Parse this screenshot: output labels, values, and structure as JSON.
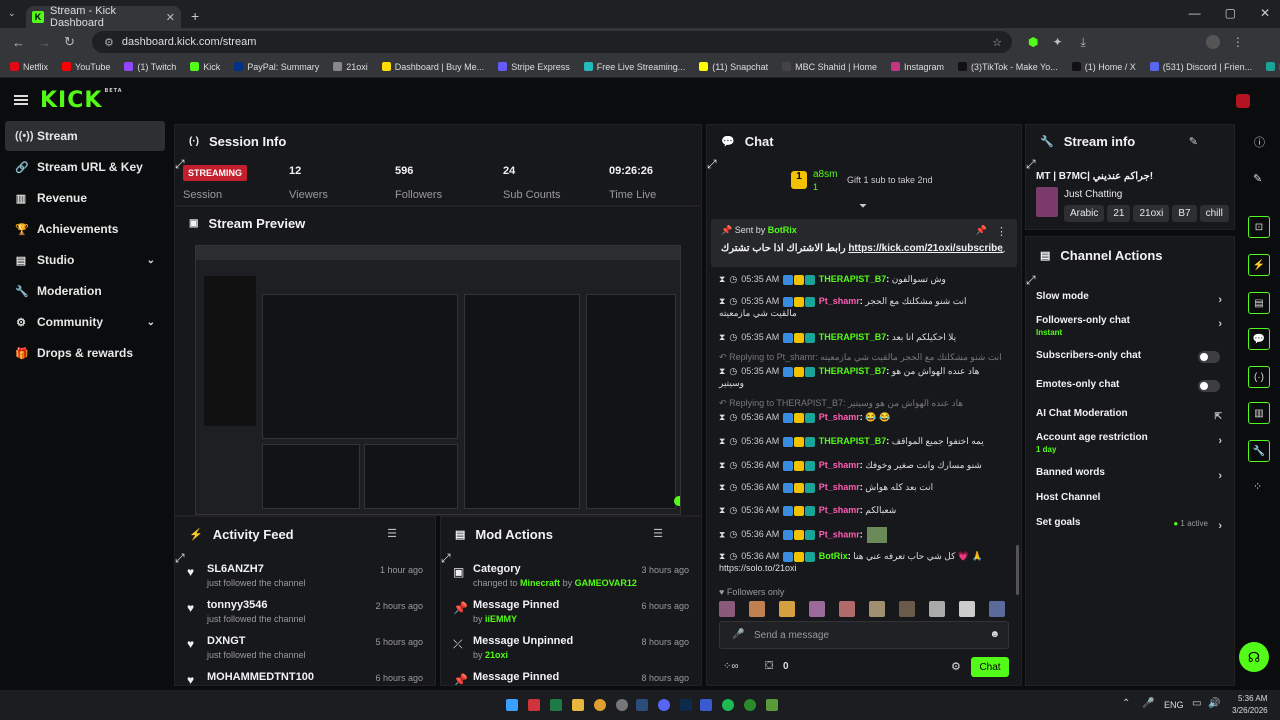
{
  "browser": {
    "tab_title": "Stream - Kick Dashboard",
    "url": "dashboard.kick.com/stream",
    "bookmarks": [
      "Netflix",
      "YouTube",
      "(1) Twitch",
      "Kick",
      "PayPal: Summary",
      "21oxi",
      "Dashboard | Buy Me...",
      "Stripe Express",
      "Free Live Streaming...",
      "(11) Snapchat",
      "MBC Shahid | Home",
      "Instagram",
      "(3)TikTok - Make Yo...",
      "(1) Home / X",
      "(531) Discord | Frien...",
      "Photopea | Online P..."
    ]
  },
  "app": {
    "logo": "KICK",
    "beta": "BETA"
  },
  "sidebar": {
    "items": [
      {
        "label": "Stream",
        "icon": "broadcast-icon"
      },
      {
        "label": "Stream URL & Key",
        "icon": "link-icon"
      },
      {
        "label": "Revenue",
        "icon": "chart-icon"
      },
      {
        "label": "Achievements",
        "icon": "trophy-icon"
      },
      {
        "label": "Studio",
        "icon": "studio-icon"
      },
      {
        "label": "Moderation",
        "icon": "wrench-icon"
      },
      {
        "label": "Community",
        "icon": "community-icon"
      },
      {
        "label": "Drops & rewards",
        "icon": "gift-icon"
      }
    ]
  },
  "session": {
    "title": "Session Info",
    "status": "STREAMING",
    "status_label": "Session",
    "viewers": "12",
    "viewers_label": "Viewers",
    "followers": "596",
    "followers_label": "Followers",
    "subs": "24",
    "subs_label": "Sub Counts",
    "time": "09:26:26",
    "time_label": "Time Live"
  },
  "preview": {
    "title": "Stream Preview"
  },
  "activity": {
    "title": "Activity Feed",
    "items": [
      {
        "name": "SL6ANZH7",
        "sub": "just followed the channel",
        "time": "1 hour ago"
      },
      {
        "name": "tonnyy3546",
        "sub": "just followed the channel",
        "time": "2 hours ago"
      },
      {
        "name": "DXNGT",
        "sub": "just followed the channel",
        "time": "5 hours ago"
      },
      {
        "name": "MOHAMMEDTNT100",
        "sub": "",
        "time": "6 hours ago"
      }
    ]
  },
  "mod": {
    "title": "Mod Actions",
    "items": [
      {
        "title": "Category",
        "pre": "changed to ",
        "hl": "Minecraft",
        "mid": " by ",
        "user": "GAMEOVAR12",
        "time": "3 hours ago"
      },
      {
        "title": "Message Pinned",
        "pre": "by ",
        "hl": "",
        "mid": "",
        "user": "iiEMMY",
        "time": "6 hours ago"
      },
      {
        "title": "Message Unpinned",
        "pre": "by ",
        "hl": "",
        "mid": "",
        "user": "21oxi",
        "time": "8 hours ago"
      },
      {
        "title": "Message Pinned",
        "pre": "",
        "hl": "",
        "mid": "",
        "user": "",
        "time": "8 hours ago"
      }
    ]
  },
  "chat": {
    "title": "Chat",
    "gifter": "a8sm",
    "gifter_count": "1",
    "gift_text": "Gift 1 sub to take 2nd",
    "pinned_by_label": "Sent by",
    "pinned_by": "BotRix",
    "pinned_text": "رابط الاشتراك اذا حاب تشترك",
    "pinned_link": "https://kick.com/21oxi/subscribe",
    "messages": [
      {
        "time": "05:35 AM",
        "user": "THERAPIST_B7",
        "color": "g",
        "text": "وش تسوالفون"
      },
      {
        "time": "05:35 AM",
        "user": "Pt_shamr",
        "color": "p",
        "text": "انت شنو مشكلتك مع الحجر",
        "text2": "مالقيت شي مازمعيته"
      },
      {
        "time": "05:35 AM",
        "user": "THERAPIST_B7",
        "color": "g",
        "text": "يلا احكيلكم انا بعد"
      },
      {
        "reply": "Replying to Pt_shamr: انت شنو مشكلتك مع الحجر مالقيت شي مازمعيته"
      },
      {
        "time": "05:35 AM",
        "user": "THERAPIST_B7",
        "color": "g",
        "text": "هاد عنده الهواش من هو",
        "text2": "وسيتير"
      },
      {
        "reply": "Replying to THERAPIST_B7: هاد عنده الهواش من هو وسيتير"
      },
      {
        "time": "05:36 AM",
        "user": "Pt_shamr",
        "color": "p",
        "text": "😂 😂"
      },
      {
        "time": "05:36 AM",
        "user": "THERAPIST_B7",
        "color": "g",
        "text": "يمه اختفوا جميع المواقف"
      },
      {
        "time": "05:36 AM",
        "user": "Pt_shamr",
        "color": "p",
        "text": "شنو مسارك وانت صغير وخوفك"
      },
      {
        "time": "05:36 AM",
        "user": "Pt_shamr",
        "color": "p",
        "text": "انت بعد كله هواش"
      },
      {
        "time": "05:36 AM",
        "user": "Pt_shamr",
        "color": "p",
        "text": "شعبالكم"
      },
      {
        "time": "05:36 AM",
        "user": "Pt_shamr",
        "color": "p",
        "text": ""
      },
      {
        "time": "05:36 AM",
        "user": "BotRix",
        "color": "g",
        "text": "كل شي حاب تعرفه عني هنا 💗 🙏",
        "text2": "https://solo.to/21oxi"
      }
    ],
    "followers_only": "Followers only",
    "placeholder": "Send a message",
    "points": "0",
    "send": "Chat"
  },
  "stream_info": {
    "title": "Stream info",
    "stream_title": "MT | B7MC| جراكم عنديني!",
    "category": "Just Chatting",
    "tags": [
      "Arabic",
      "21",
      "21oxi",
      "B7",
      "chill"
    ]
  },
  "channel_actions": {
    "title": "Channel Actions",
    "items": [
      {
        "label": "Slow mode",
        "sub": "",
        "ctl": "chevron"
      },
      {
        "label": "Followers-only chat",
        "sub": "Instant",
        "ctl": "chevron"
      },
      {
        "label": "Subscribers-only chat",
        "sub": "",
        "ctl": "toggle"
      },
      {
        "label": "Emotes-only chat",
        "sub": "",
        "ctl": "toggle"
      },
      {
        "label": "AI Chat Moderation",
        "sub": "",
        "ctl": "external"
      },
      {
        "label": "Account age restriction",
        "sub": "1 day",
        "ctl": "chevron"
      },
      {
        "label": "Banned words",
        "sub": "",
        "ctl": "chevron"
      },
      {
        "label": "Host Channel",
        "sub": "",
        "ctl": "none"
      },
      {
        "label": "Set goals",
        "sub": "",
        "ctl": "chevron",
        "status": "1 active"
      }
    ]
  },
  "taskbar": {
    "lang": "ENG",
    "time": "5:36 AM",
    "date": "3/26/2026"
  },
  "colors": {
    "accent": "#53fc18",
    "live": "#c41f2d",
    "panel": "#17181b",
    "bg": "#0b0c0d"
  }
}
